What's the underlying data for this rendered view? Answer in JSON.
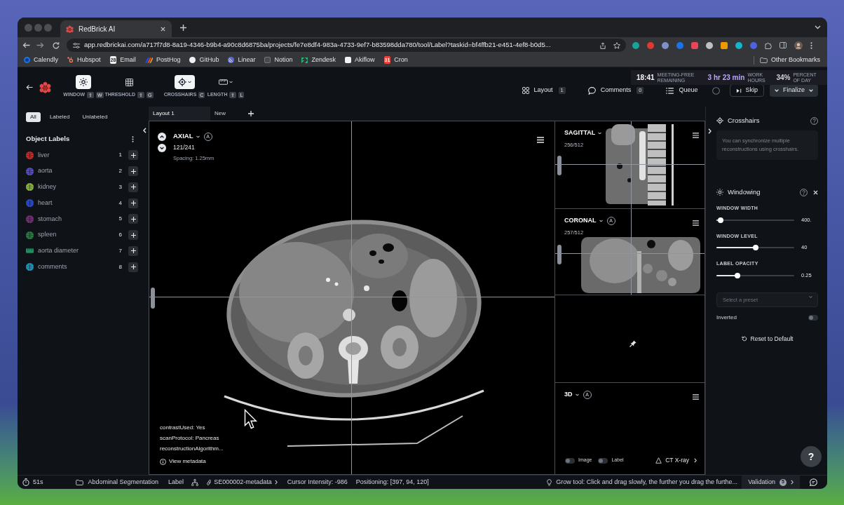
{
  "browser": {
    "tab_title": "RedBrick AI",
    "url": "app.redbrickai.com/a717f7d8-8a19-4346-b9b4-a90c8d6875ba/projects/fe7e8df4-983a-4733-9ef7-b83598dda780/tool/Label?taskid=bf4ffb21-e451-4ef8-b0d5...",
    "bookmarks": [
      {
        "label": "Calendly"
      },
      {
        "label": "Hubspot"
      },
      {
        "label": "Email",
        "badge": "28"
      },
      {
        "label": "PostHog"
      },
      {
        "label": "GitHub"
      },
      {
        "label": "Linear"
      },
      {
        "label": "Notion"
      },
      {
        "label": "Zendesk"
      },
      {
        "label": "Akiflow"
      },
      {
        "label": "Cron",
        "badge": "31"
      }
    ],
    "other_bookmarks": "Other Bookmarks"
  },
  "time_widget": [
    {
      "value": "18:41",
      "label": "MEETING-FREE REMAINING"
    },
    {
      "value": "3 hr 23 min",
      "label": "WORK HOURS"
    },
    {
      "value": "34%",
      "label": "PERCENT OF DAY"
    }
  ],
  "toolbar": {
    "tools": [
      {
        "kind": "window",
        "label": "WINDOW",
        "keys": [
          "⇧",
          "W"
        ],
        "selected": true,
        "dropdown": false
      },
      {
        "kind": "threshold",
        "label": "THRESHOLD",
        "keys": [
          "⇧",
          "G"
        ],
        "selected": false,
        "dropdown": false
      },
      {
        "kind": "crosshairs",
        "label": "CROSSHAIRS",
        "keys": [
          "C"
        ],
        "selected": true,
        "dropdown": true
      },
      {
        "kind": "length",
        "label": "LENGTH",
        "keys": [
          "⇧",
          "L"
        ],
        "selected": false,
        "dropdown": true
      }
    ],
    "actions": [
      {
        "kind": "layout",
        "label": "Layout",
        "badge": "1"
      },
      {
        "kind": "comments",
        "label": "Comments",
        "badge": "0"
      },
      {
        "kind": "queue",
        "label": "Queue"
      }
    ],
    "skip": "Skip",
    "finalize": "Finalize"
  },
  "label_filters": [
    {
      "label": "All",
      "selected": true
    },
    {
      "label": "Labeled",
      "selected": false
    },
    {
      "label": "Unlabeled",
      "selected": false
    }
  ],
  "object_labels": {
    "title": "Object Labels",
    "items": [
      {
        "kind": "segment",
        "name": "liver",
        "count": "1",
        "color": "#c43030"
      },
      {
        "kind": "segment",
        "name": "aorta",
        "count": "2",
        "color": "#5a4fcf"
      },
      {
        "kind": "segment",
        "name": "kidney",
        "count": "3",
        "color": "#8fbf3a"
      },
      {
        "kind": "segment",
        "name": "heart",
        "count": "4",
        "color": "#2f4fd0"
      },
      {
        "kind": "segment",
        "name": "stomach",
        "count": "5",
        "color": "#7a2f7f"
      },
      {
        "kind": "segment",
        "name": "spleen",
        "count": "6",
        "color": "#2e7d4a"
      },
      {
        "kind": "measurement",
        "name": "aorta diameter",
        "count": "7",
        "color": "#1f8f5f"
      },
      {
        "kind": "segment",
        "name": "comments",
        "count": "8",
        "color": "#1aa0c8"
      }
    ]
  },
  "layout_tabs": [
    {
      "label": "Layout 1",
      "selected": true
    },
    {
      "label": "New",
      "selected": false
    }
  ],
  "main_viewport": {
    "plane": "AXIAL",
    "badge": "A",
    "slice": "121/241",
    "spacing": "Spacing: 1.25mm",
    "metadata": [
      "contrastUsed: Yes",
      "scanProtocol: Pancreas",
      "reconstructionAlgorithm..."
    ],
    "view_metadata": "View metadata"
  },
  "side_viewports": [
    {
      "kind": "sagittal",
      "plane": "SAGITTAL",
      "slice": "256/512"
    },
    {
      "kind": "coronal",
      "plane": "CORONAL",
      "badge": "A",
      "slice": "257/512"
    },
    {
      "kind": "empty"
    },
    {
      "kind": "volume",
      "plane": "3D",
      "badge": "A",
      "toggles": [
        {
          "label": "Image",
          "on": false
        },
        {
          "label": "Label",
          "on": false
        }
      ],
      "modality": "CT X-ray"
    }
  ],
  "crosshairs": {
    "title": "Crosshairs",
    "info": "You can synchronize multiple reconstructions using crosshairs."
  },
  "windowing": {
    "title": "Windowing",
    "sliders": [
      {
        "label": "WINDOW WIDTH",
        "level": 0.02,
        "value": "400."
      },
      {
        "label": "WINDOW LEVEL",
        "level": 0.5,
        "value": "40"
      },
      {
        "label": "LABEL OPACITY",
        "level": 0.25,
        "value": "0.25"
      }
    ],
    "preset": {
      "placeholder": "Select a preset"
    },
    "inverted": {
      "label": "Inverted",
      "on": false
    },
    "reset": "Reset to Default"
  },
  "help_button": "?",
  "status_bar": {
    "timer": "51s",
    "project": "Abdominal Segmentation",
    "stage": "Label",
    "series": "SE000002-metadata",
    "cursor_intensity": "Cursor Intensity: -986",
    "positioning": "Positioning: [397, 94, 120]",
    "hint": "Grow tool: Click and drag slowly, the further you drag the furthe...",
    "validation": {
      "label": "Validation",
      "badge": "5"
    }
  }
}
